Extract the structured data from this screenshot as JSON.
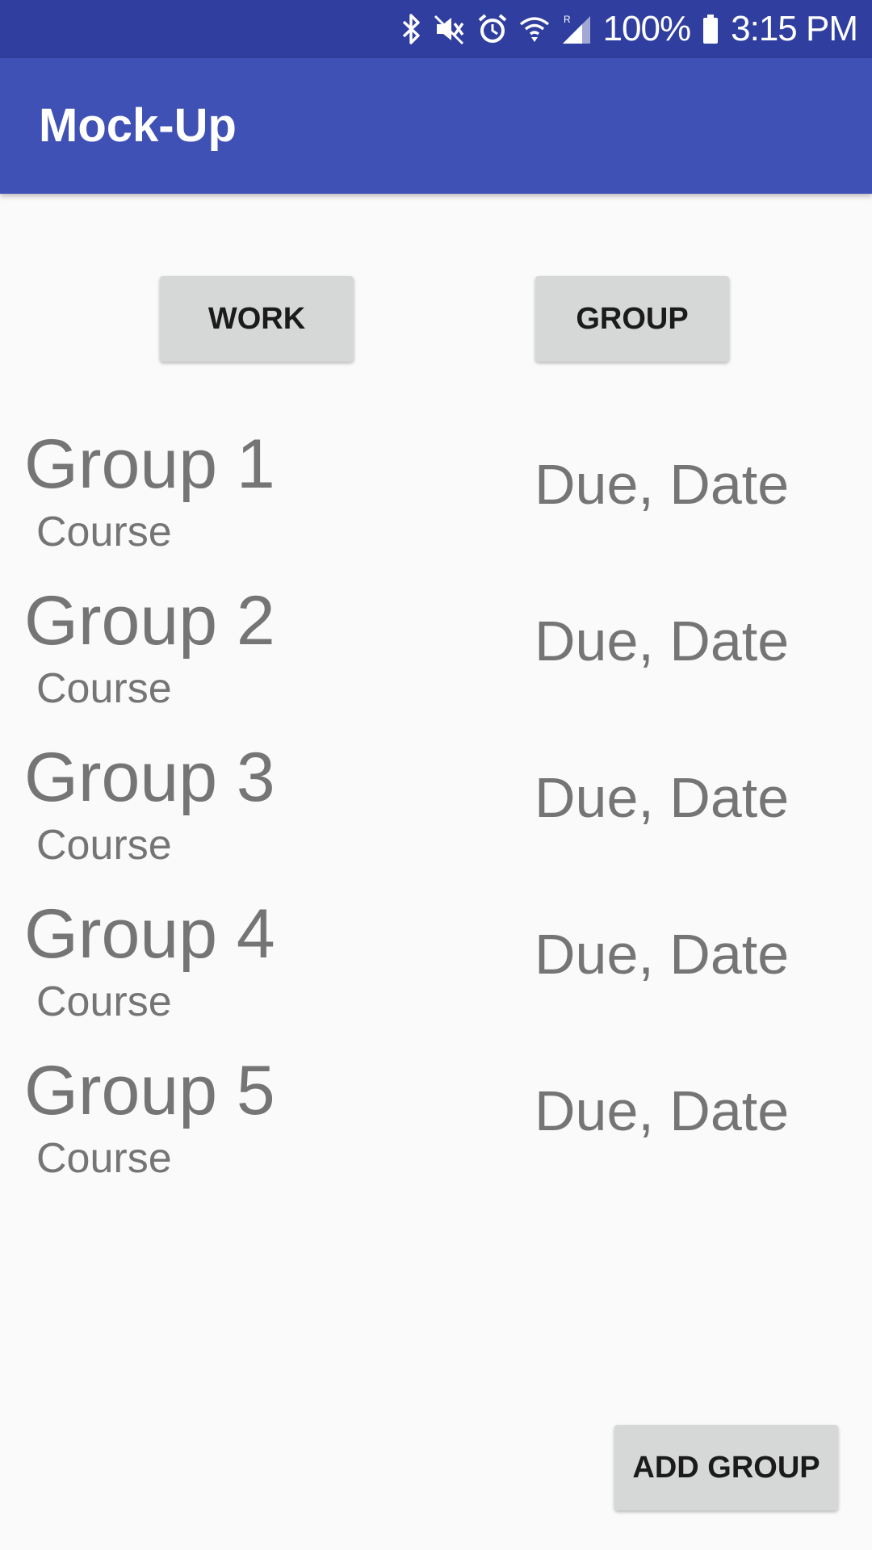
{
  "status_bar": {
    "battery": "100%",
    "time": "3:15 PM",
    "icons": [
      "bluetooth-icon",
      "mute-icon",
      "alarm-icon",
      "wifi-icon",
      "cell-signal-icon",
      "battery-icon"
    ]
  },
  "app_bar": {
    "title": "Mock-Up"
  },
  "tabs": {
    "work_label": "WORK",
    "group_label": "GROUP"
  },
  "groups": [
    {
      "name": "Group 1",
      "course": "Course",
      "due": "Due, Date"
    },
    {
      "name": "Group 2",
      "course": "Course",
      "due": "Due, Date"
    },
    {
      "name": "Group 3",
      "course": "Course",
      "due": "Due, Date"
    },
    {
      "name": "Group 4",
      "course": "Course",
      "due": "Due, Date"
    },
    {
      "name": "Group 5",
      "course": "Course",
      "due": "Due, Date"
    }
  ],
  "footer": {
    "add_group_label": "ADD GROUP"
  },
  "colors": {
    "status_bar": "#303f9f",
    "app_bar": "#3f51b5",
    "background": "#fafafa",
    "button": "#d6d7d7",
    "list_text": "#757575"
  }
}
